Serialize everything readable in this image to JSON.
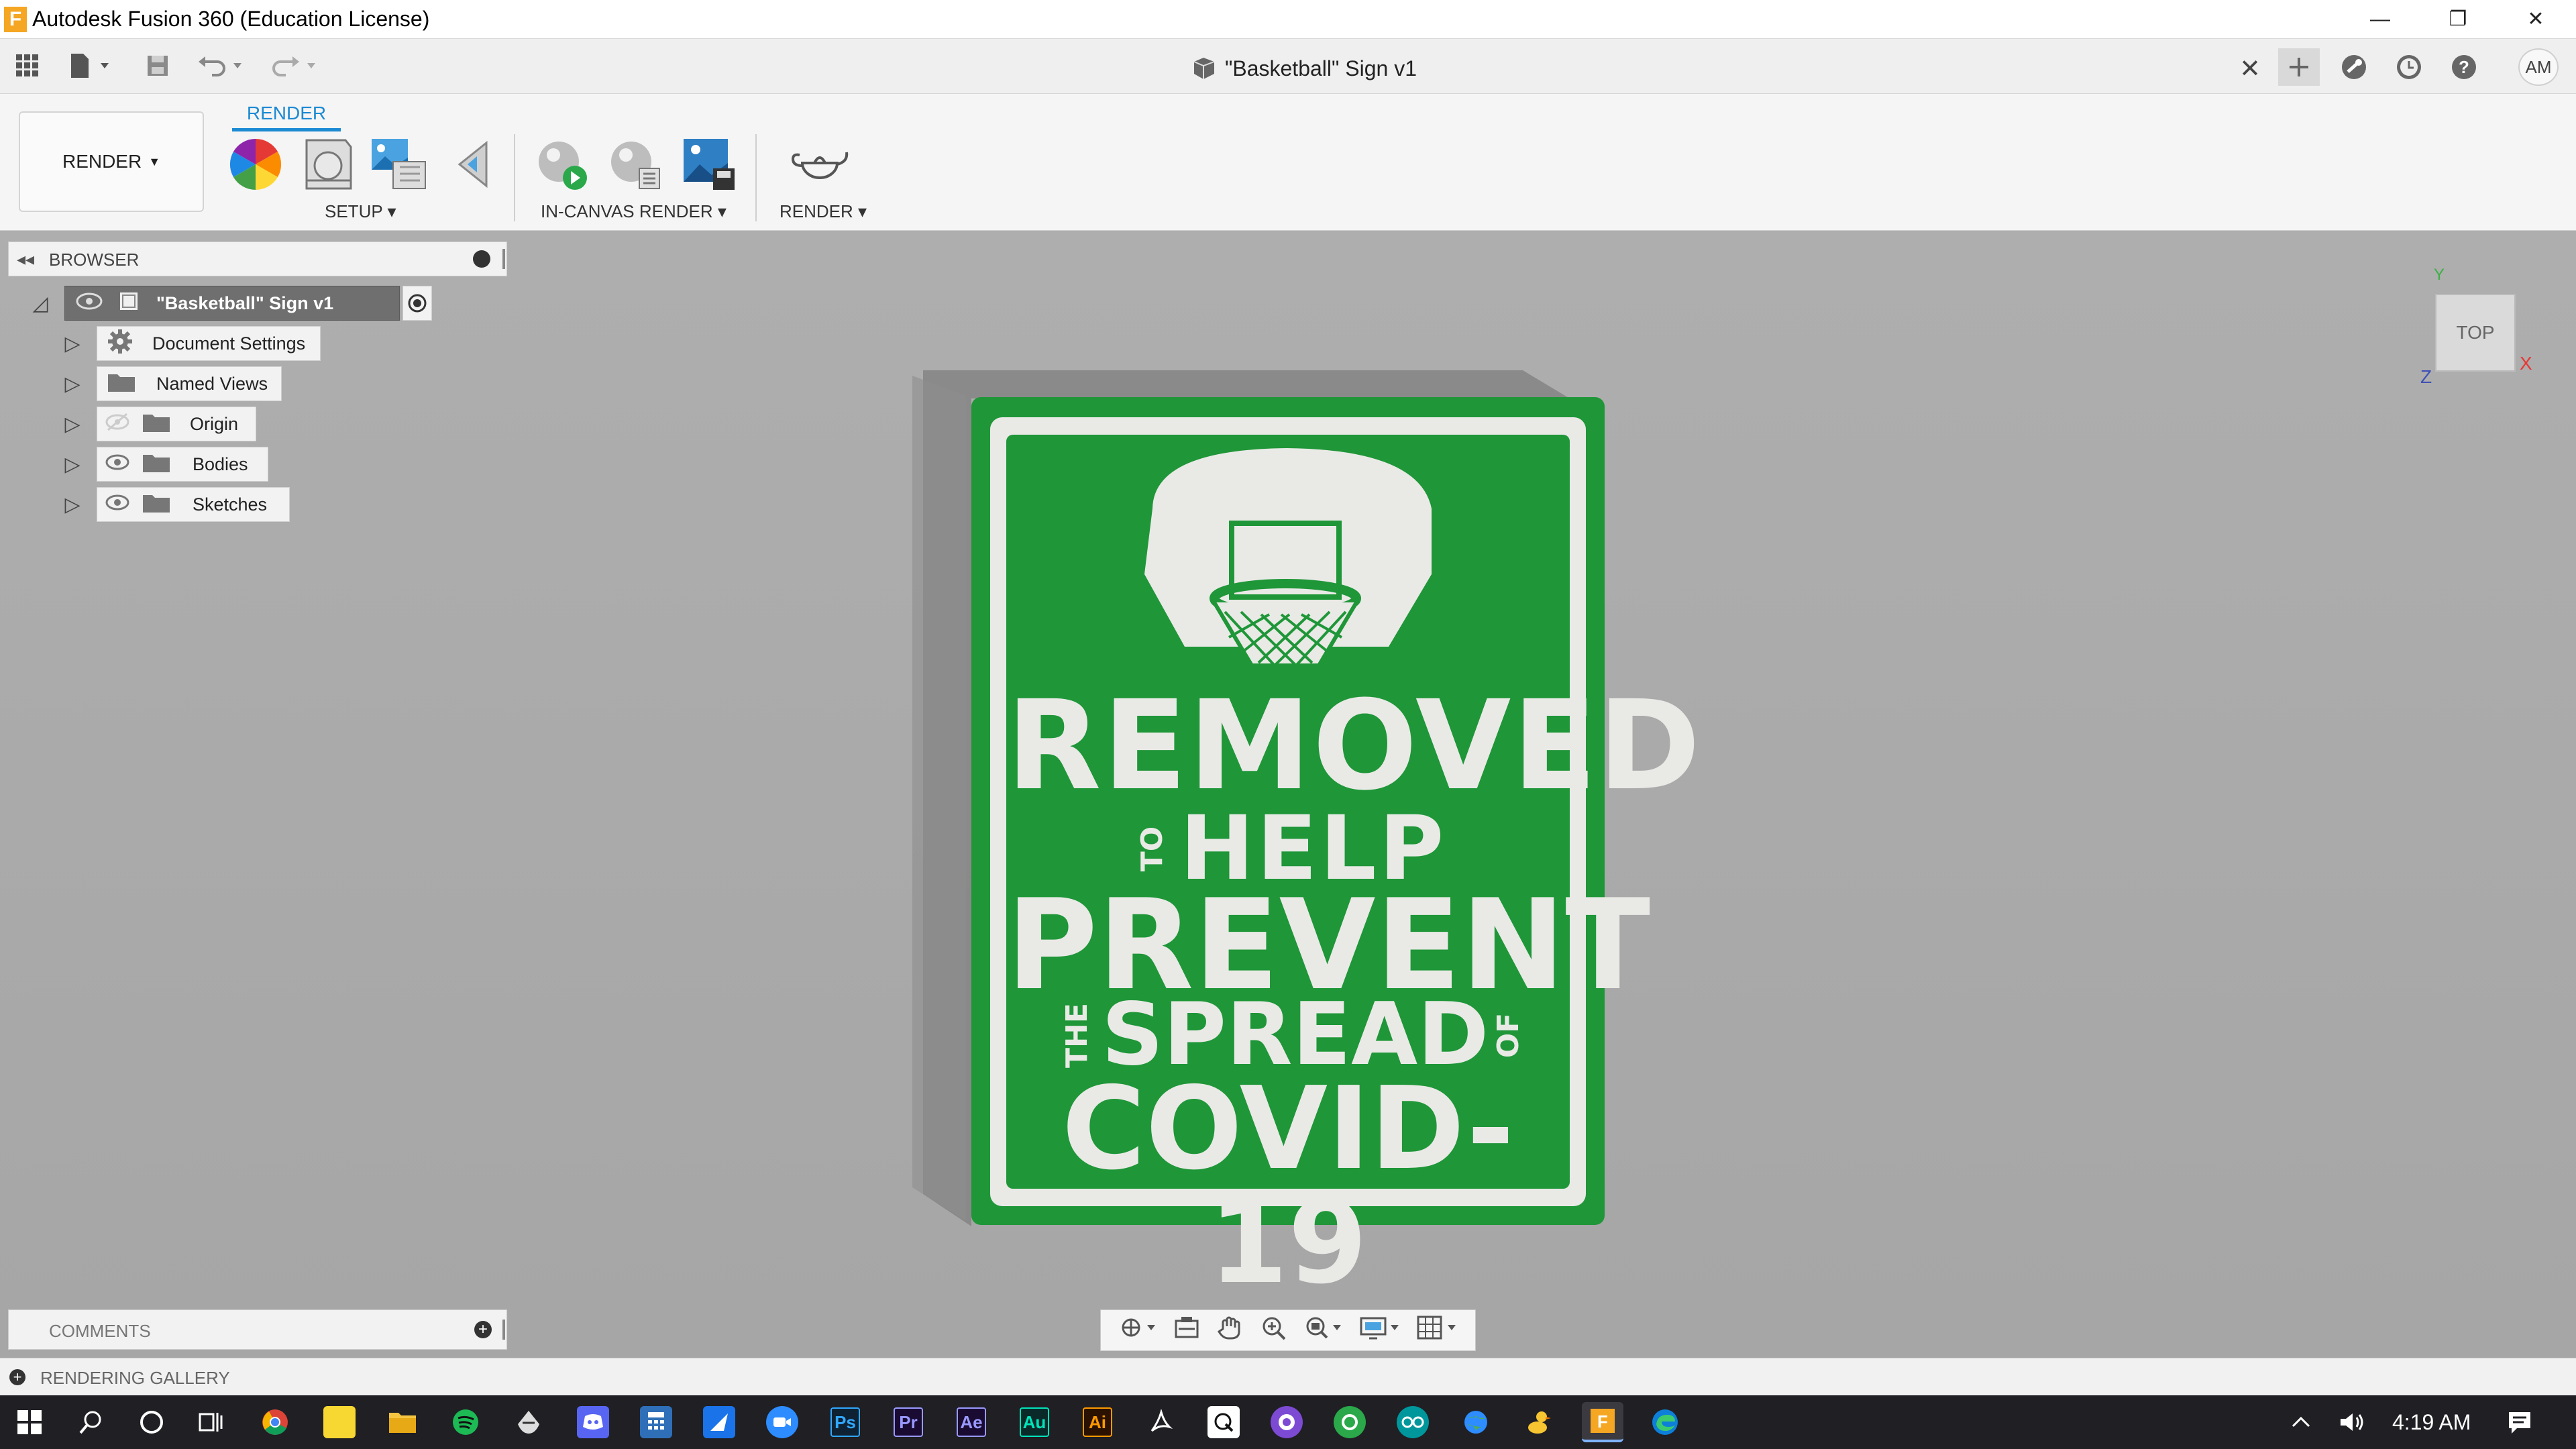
{
  "window": {
    "title": "Autodesk Fusion 360 (Education License)",
    "logo_letter": "F",
    "minimize": "—",
    "restore": "❐",
    "close": "✕"
  },
  "doc_tab": {
    "title": "\"Basketball\" Sign v1",
    "close": "✕"
  },
  "user": {
    "initials": "AM"
  },
  "ribbon": {
    "workspace": "RENDER",
    "active_tab": "RENDER",
    "groups": [
      {
        "label": "SETUP"
      },
      {
        "label": "IN-CANVAS RENDER"
      },
      {
        "label": "RENDER"
      }
    ]
  },
  "browser": {
    "title": "BROWSER",
    "root": "\"Basketball\" Sign v1",
    "items": [
      {
        "label": "Document Settings",
        "icon": "gear-icon"
      },
      {
        "label": "Named Views",
        "icon": "folder-icon"
      },
      {
        "label": "Origin",
        "icon": "folder-icon"
      },
      {
        "label": "Bodies",
        "icon": "folder-icon"
      },
      {
        "label": "Sketches",
        "icon": "folder-icon"
      }
    ]
  },
  "viewcube": {
    "face": "TOP",
    "axis_y": "Y",
    "axis_x": "X",
    "axis_z": "Z"
  },
  "sign": {
    "line1": "REMOVED",
    "line2_small": "TO",
    "line2": "HELP",
    "line3": "PREVENT",
    "line4_small_left": "THE",
    "line4": "SPREAD",
    "line4_small_right": "OF",
    "line5": "COVID-19",
    "green": "#1f9638",
    "cream": "#e9eae6"
  },
  "comments": {
    "title": "COMMENTS"
  },
  "gallery": {
    "title": "RENDERING GALLERY"
  },
  "taskbar": {
    "time": "4:19 AM",
    "apps": [
      {
        "name": "Ps",
        "color": "#0e2233",
        "text": "#31a8ff"
      },
      {
        "name": "Pr",
        "color": "#1a0b33",
        "text": "#9999ff"
      },
      {
        "name": "Ae",
        "color": "#1a0b33",
        "text": "#9999ff"
      },
      {
        "name": "Au",
        "color": "#0a2a2a",
        "text": "#00e4bb"
      },
      {
        "name": "Ai",
        "color": "#2b1200",
        "text": "#ff9a00"
      }
    ]
  }
}
